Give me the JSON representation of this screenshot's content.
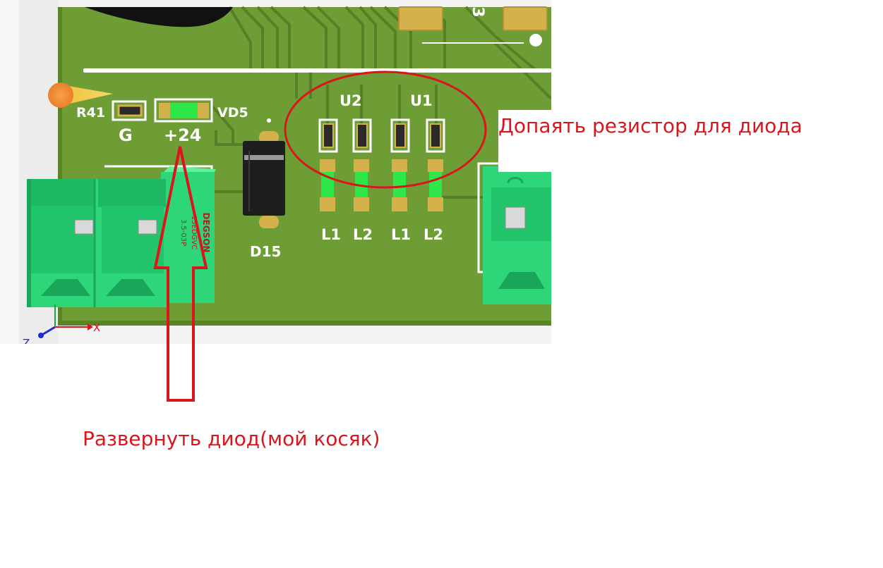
{
  "pcb": {
    "labels": {
      "r41": "R41",
      "vd5": "VD5",
      "g": "G",
      "plus24": "+24",
      "d15": "D15",
      "u2": "U2",
      "u1": "U1",
      "l1a": "L1",
      "l2a": "L2",
      "l1b": "L1",
      "l2b": "L2",
      "top_digit": "3",
      "connector_text": [
        "DEGSON",
        "15EDGVC",
        "3.5-03P"
      ]
    },
    "axes": {
      "x": "X",
      "z": "Z"
    },
    "colors": {
      "board": "#6e9c35",
      "trace": "#577f27",
      "connector": "#2ed67a",
      "pad": "#d4b14a",
      "led": "#2ee84a",
      "annotation": "#d9161b"
    }
  },
  "annotations": {
    "resistor_note": "Допаять резистор для диода",
    "diode_note": "Развернуть диод(мой косяк)"
  }
}
